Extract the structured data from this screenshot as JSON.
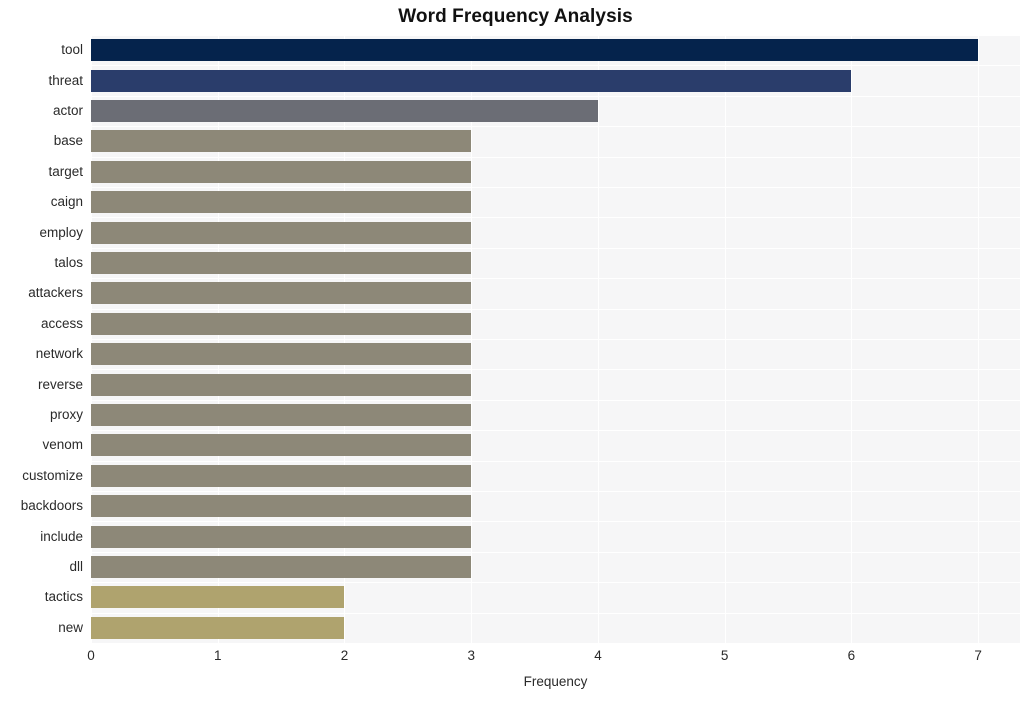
{
  "chart_data": {
    "type": "bar",
    "orientation": "horizontal",
    "title": "Word Frequency Analysis",
    "xlabel": "Frequency",
    "ylabel": "",
    "xlim": [
      0,
      7.33
    ],
    "xticks": [
      0,
      1,
      2,
      3,
      4,
      5,
      6,
      7
    ],
    "xticklabels": [
      "0",
      "1",
      "2",
      "3",
      "4",
      "5",
      "6",
      "7"
    ],
    "grid": true,
    "legend": null,
    "categories": [
      "tool",
      "threat",
      "actor",
      "base",
      "target",
      "caign",
      "employ",
      "talos",
      "attackers",
      "access",
      "network",
      "reverse",
      "proxy",
      "venom",
      "customize",
      "backdoors",
      "include",
      "dll",
      "tactics",
      "new"
    ],
    "values": [
      7,
      6,
      4,
      3,
      3,
      3,
      3,
      3,
      3,
      3,
      3,
      3,
      3,
      3,
      3,
      3,
      3,
      3,
      2,
      2
    ],
    "bar_colors": [
      "#05234c",
      "#2a3d6b",
      "#6b6d75",
      "#8d8878",
      "#8d8878",
      "#8d8878",
      "#8d8878",
      "#8d8878",
      "#8d8878",
      "#8d8878",
      "#8d8878",
      "#8d8878",
      "#8d8878",
      "#8d8878",
      "#8d8878",
      "#8d8878",
      "#8d8878",
      "#8d8878",
      "#afa36e",
      "#afa36e"
    ],
    "plot_background": "#f6f6f7",
    "grid_color": "#ffffff",
    "figure_background": "#ffffff",
    "title_color": "#111111",
    "tick_color": "#2a2a2a"
  }
}
